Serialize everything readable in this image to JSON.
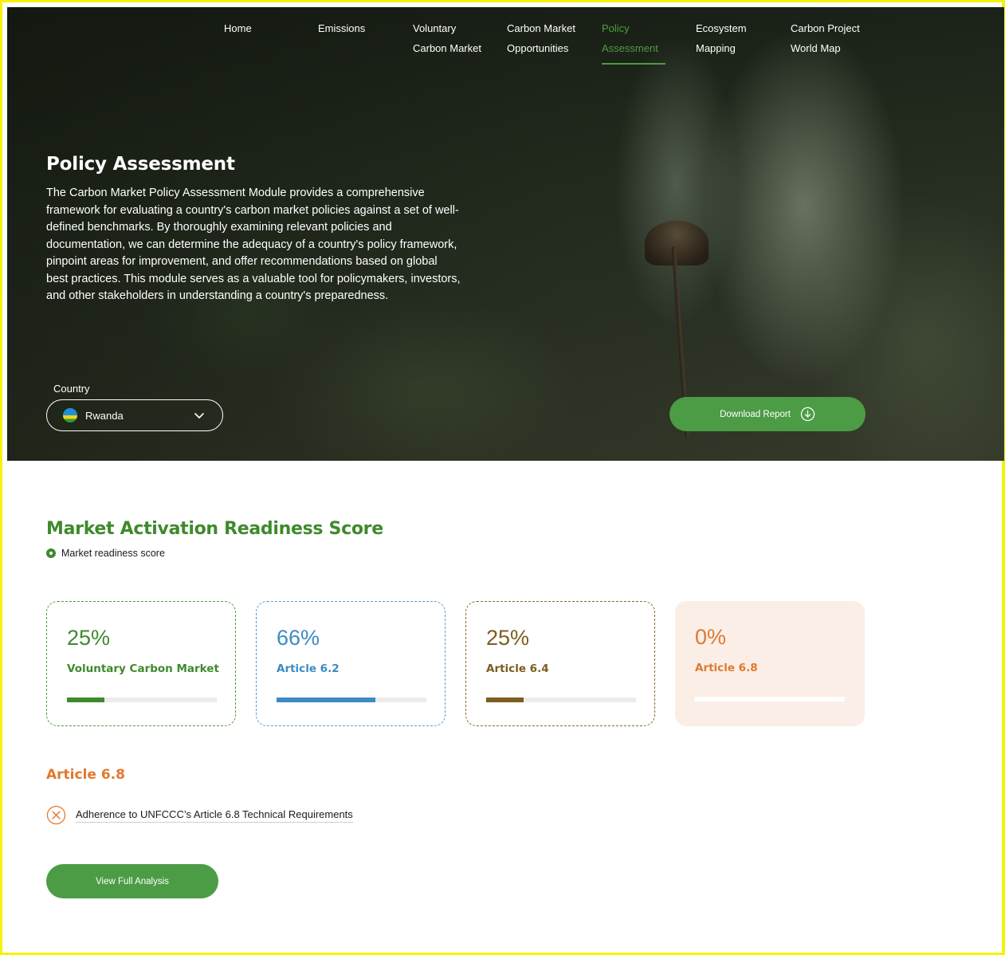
{
  "nav": {
    "items": [
      {
        "line1": "Home",
        "line2": ""
      },
      {
        "line1": "Emissions",
        "line2": ""
      },
      {
        "line1": "Voluntary",
        "line2": "Carbon Market"
      },
      {
        "line1": "Carbon Market",
        "line2": "Opportunities"
      },
      {
        "line1": "Policy",
        "line2": "Assessment"
      },
      {
        "line1": "Ecosystem",
        "line2": "Mapping"
      },
      {
        "line1": "Carbon Project",
        "line2": "World Map"
      }
    ],
    "active_index": 4
  },
  "hero": {
    "title": "Policy Assessment",
    "description": "The Carbon Market Policy Assessment Module provides a comprehensive framework for evaluating a country's carbon market policies against a set of well-defined benchmarks. By thoroughly examining relevant policies and documentation, we can determine the adequacy of a country's policy framework, pinpoint areas for improvement, and offer recommendations based on global best practices. This module serves as a valuable tool for policymakers, investors, and other stakeholders in understanding a country's preparedness.",
    "country_label": "Country",
    "country_value": "Rwanda",
    "download_label": "Download Report"
  },
  "readiness": {
    "title": "Market Activation Readiness Score",
    "legend": "Market readiness score",
    "cards": [
      {
        "percent": "25%",
        "value": 0.25,
        "name": "Voluntary Carbon Market",
        "color": "#3f8a2c"
      },
      {
        "percent": "66%",
        "value": 0.66,
        "name": "Article 6.2",
        "color": "#3d8bc4"
      },
      {
        "percent": "25%",
        "value": 0.25,
        "name": "Article 6.4",
        "color": "#7d5d1f"
      },
      {
        "percent": "0%",
        "value": 0.0,
        "name": "Article 6.8",
        "color": "#e0792f"
      }
    ]
  },
  "article": {
    "title": "Article 6.8",
    "item": "Adherence to UNFCCC’s Article 6.8 Technical Requirements",
    "view_label": "View Full Analysis"
  }
}
